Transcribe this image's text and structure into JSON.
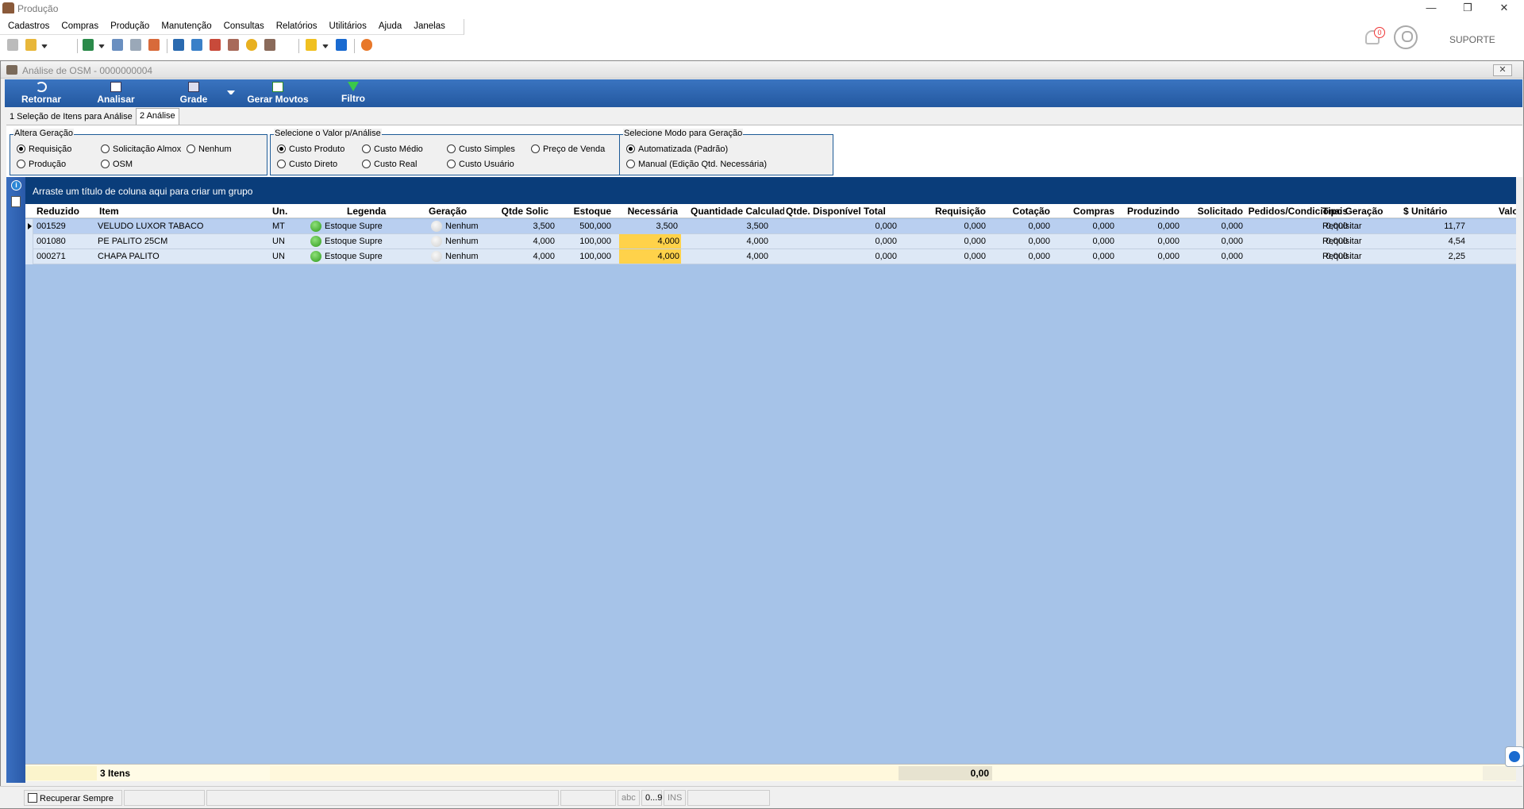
{
  "window": {
    "title": "Produção",
    "min": "—",
    "max": "❐",
    "close": "✕"
  },
  "menu": [
    "Cadastros",
    "Compras",
    "Produção",
    "Manutenção",
    "Consultas",
    "Relatórios",
    "Utilitários",
    "Ajuda",
    "Janelas"
  ],
  "notifications": {
    "count": "0"
  },
  "user": {
    "name": "SUPORTE"
  },
  "child": {
    "title": "Análise de OSM - 0000000004",
    "close": "✕"
  },
  "ribbon": {
    "retornar": "Retornar",
    "analisar": "Analisar",
    "grade": "Grade",
    "gerar": "Gerar Movtos",
    "filtro": "Filtro"
  },
  "tabs": [
    "1 Seleção de Itens para Análise",
    "2 Análise"
  ],
  "groups": {
    "altera": {
      "caption": "Altera Geração",
      "options": [
        "Requisição",
        "Solicitação Almox",
        "Nenhum",
        "Produção",
        "OSM"
      ],
      "selected": "Requisição"
    },
    "valor": {
      "caption": "Selecione o Valor p/Análise",
      "options": [
        "Custo Produto",
        "Custo Médio",
        "Custo Simples",
        "Preço de Venda",
        "Custo Direto",
        "Custo Real",
        "Custo Usuário"
      ],
      "selected": "Custo Produto"
    },
    "modo": {
      "caption": "Selecione Modo para Geração",
      "options": [
        "Automatizada (Padrão)",
        "Manual (Edição Qtd. Necessária)"
      ],
      "selected": "Automatizada (Padrão)"
    }
  },
  "groupbar": "Arraste um título de coluna aqui para criar um grupo",
  "columns": [
    "Reduzido",
    "Item",
    "Un.",
    "Legenda",
    "Geração",
    "Qtde Solic",
    "Estoque",
    "Necessária",
    "Quantidade Calculada",
    "Qtde. Disponível Total",
    "Requisição",
    "Cotação",
    "Compras",
    "Produzindo",
    "Solicitado",
    "Pedidos/Condicionais",
    "Tipo Geração",
    "$ Unitário",
    "Valor"
  ],
  "rows": [
    {
      "reduzido": "001529",
      "item": "VELUDO LUXOR TABACO",
      "un": "MT",
      "legenda": "Estoque Supre",
      "geracao": "Nenhum",
      "qtde": "3,500",
      "estoque": "500,000",
      "necessaria": "3,500",
      "calc": "3,500",
      "disp": "0,000",
      "req": "0,000",
      "cot": "0,000",
      "compras": "0,000",
      "prod": "0,000",
      "solic": "0,000",
      "pedidos": "0,000",
      "tipo": "Requisitar",
      "unit": "11,77"
    },
    {
      "reduzido": "001080",
      "item": "PE PALITO 25CM",
      "un": "UN",
      "legenda": "Estoque Supre",
      "geracao": "Nenhum",
      "qtde": "4,000",
      "estoque": "100,000",
      "necessaria": "4,000",
      "calc": "4,000",
      "disp": "0,000",
      "req": "0,000",
      "cot": "0,000",
      "compras": "0,000",
      "prod": "0,000",
      "solic": "0,000",
      "pedidos": "0,000",
      "tipo": "Requisitar",
      "unit": "4,54"
    },
    {
      "reduzido": "000271",
      "item": "CHAPA PALITO",
      "un": "UN",
      "legenda": "Estoque Supre",
      "geracao": "Nenhum",
      "qtde": "4,000",
      "estoque": "100,000",
      "necessaria": "4,000",
      "calc": "4,000",
      "disp": "0,000",
      "req": "0,000",
      "cot": "0,000",
      "compras": "0,000",
      "prod": "0,000",
      "solic": "0,000",
      "pedidos": "0,000",
      "tipo": "Requisitar",
      "unit": "2,25"
    }
  ],
  "footer": {
    "count": "3 Itens",
    "sum": "0,00"
  },
  "status": {
    "recuperar": "Recuperar Sempre",
    "abc": "abc",
    "num": "0...9",
    "ins": "INS"
  },
  "colors": {
    "ribbon": "#2a62ad",
    "groupbar": "#0a3d7a",
    "grid_bg": "#a6c3e8",
    "highlight": "#ffd24a"
  }
}
